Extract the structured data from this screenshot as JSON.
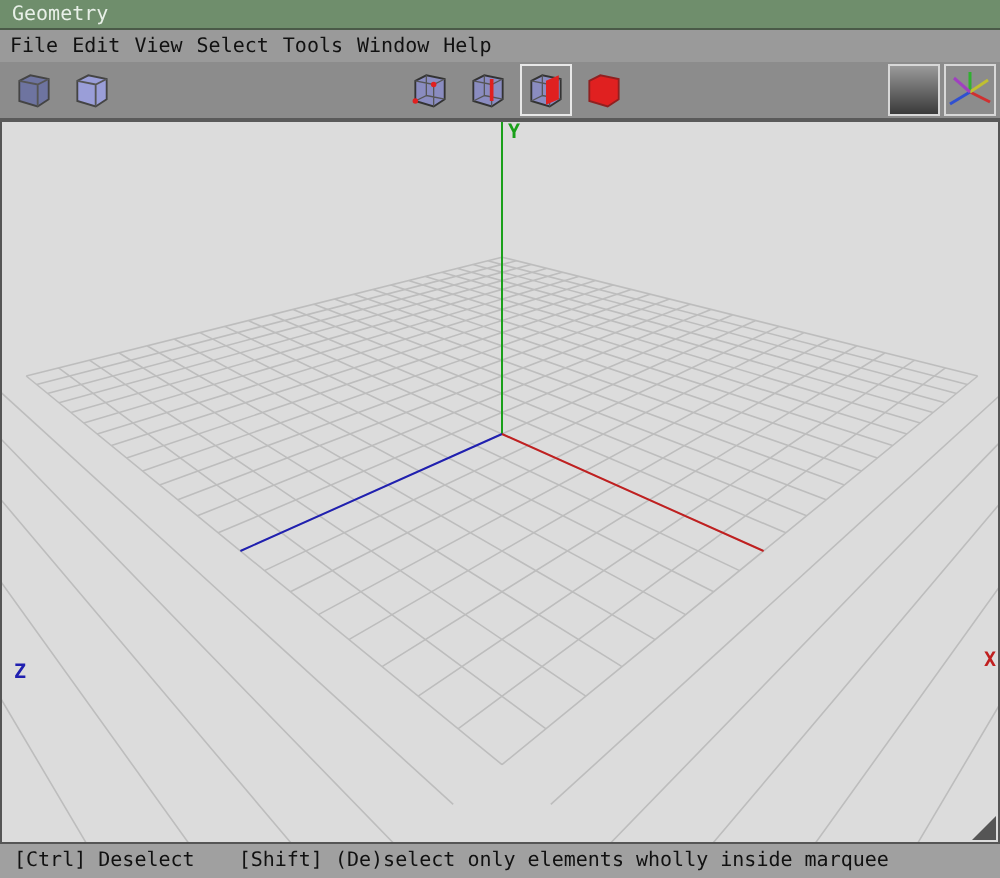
{
  "window": {
    "title": "Geometry"
  },
  "menu": [
    "File",
    "Edit",
    "View",
    "Select",
    "Tools",
    "Window",
    "Help"
  ],
  "selection_modes": [
    {
      "kind": "vertex",
      "selected": false
    },
    {
      "kind": "edge",
      "selected": false
    },
    {
      "kind": "face",
      "selected": true
    },
    {
      "kind": "object",
      "selected": false
    }
  ],
  "viewport": {
    "axes": [
      {
        "kind": "y",
        "label": "Y"
      },
      {
        "kind": "z",
        "label": "Z"
      },
      {
        "kind": "x",
        "label": "X"
      }
    ]
  },
  "status_bar": [
    "[Ctrl] Deselect",
    "[Shift] (De)select only elements wholly inside marquee"
  ]
}
